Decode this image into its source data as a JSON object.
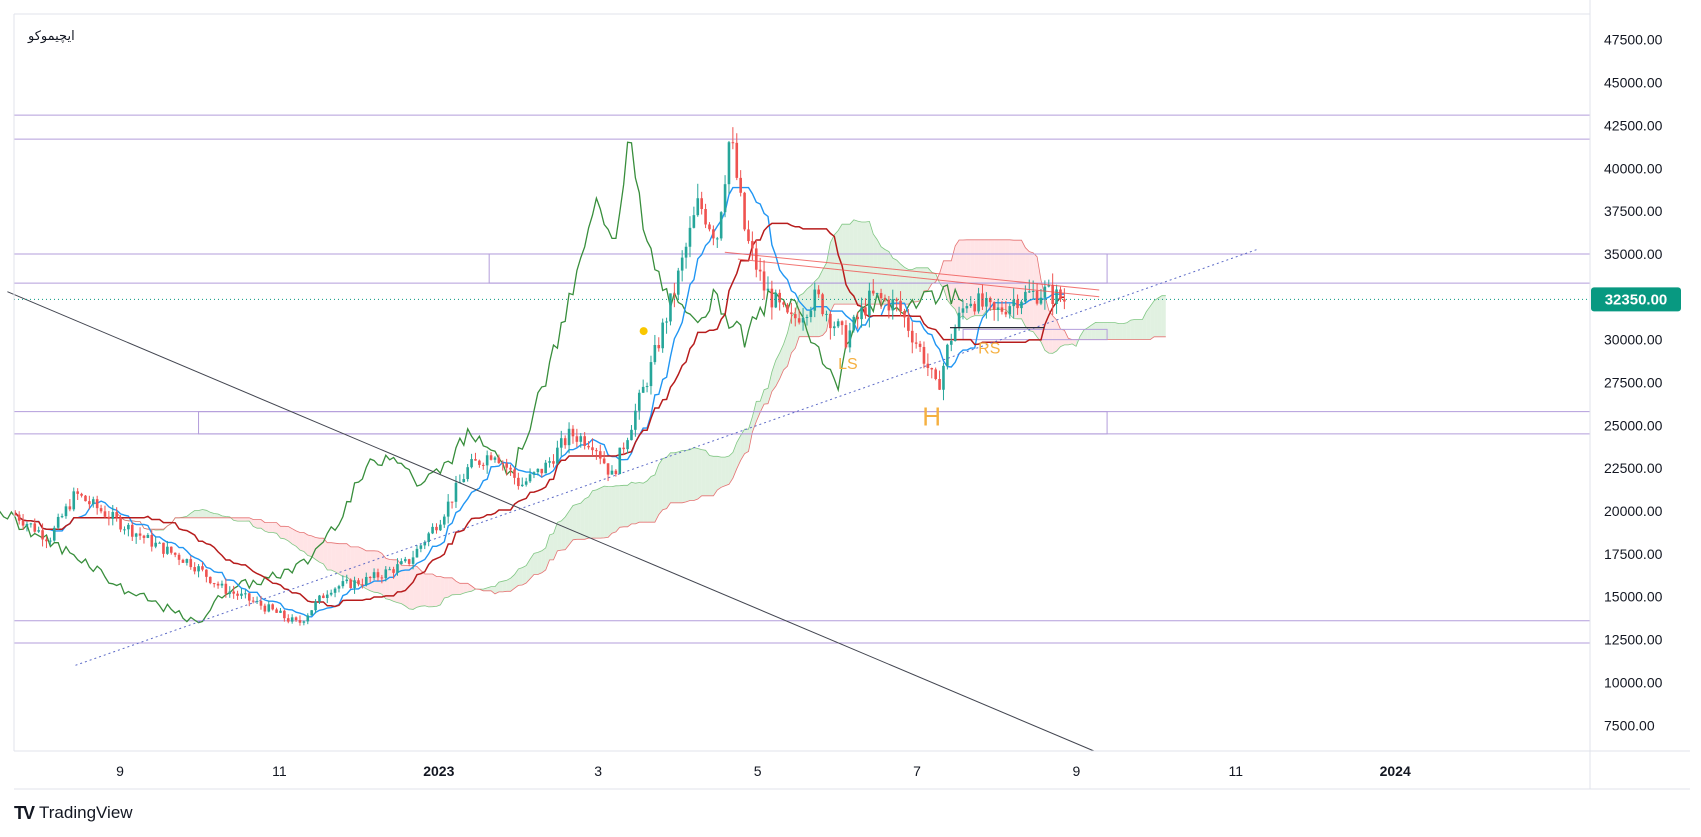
{
  "symbol": "ایچیموکو",
  "brand": {
    "logo": "TV",
    "name": "TradingView"
  },
  "colors": {
    "up": "#26a69a",
    "down": "#ef5350",
    "tenkan": "#2196f3",
    "kijun": "#b71c1c",
    "chikou": "#388e3c",
    "cloud_bull": "#c8e6c9",
    "cloud_bear": "#ffcdd2",
    "zone_border": "#b39ddb",
    "trendline": "#434651",
    "dotted_trend": "#5d6bc7",
    "price_badge": "#089981",
    "pattern_label": "#f5b041",
    "axis_text": "#131722",
    "grid_border": "#e0e3eb"
  },
  "chart_data": {
    "type": "candlestick",
    "indicator": "ichimoku",
    "price_axis": {
      "ticks": [
        47500,
        45000,
        42500,
        40000,
        37500,
        35000,
        32500,
        30000,
        27500,
        25000,
        22500,
        20000,
        17500,
        15000,
        12500,
        10000,
        7500
      ],
      "tick_labels": [
        "47500.00",
        "45000.00",
        "42500.00",
        "40000.00",
        "37500.00",
        "35000.00",
        "32500.00",
        "30000.00",
        "27500.00",
        "25000.00",
        "22500.00",
        "20000.00",
        "17500.00",
        "15000.00",
        "12500.00",
        "10000.00",
        "7500.00"
      ],
      "ylim": [
        6000,
        49000
      ]
    },
    "time_axis": {
      "labels": [
        {
          "text": "9",
          "month": 0,
          "bold": false
        },
        {
          "text": "11",
          "month": 2,
          "bold": false
        },
        {
          "text": "2023",
          "month": 4,
          "bold": true
        },
        {
          "text": "3",
          "month": 6,
          "bold": false
        },
        {
          "text": "5",
          "month": 8,
          "bold": false
        },
        {
          "text": "7",
          "month": 10,
          "bold": false
        },
        {
          "text": "9",
          "month": 12,
          "bold": false
        },
        {
          "text": "11",
          "month": 14,
          "bold": false
        },
        {
          "text": "2024",
          "month": 16,
          "bold": true
        }
      ]
    },
    "last_price": 32350,
    "last_price_label": "32350.00",
    "horizontal_lines": [
      43100,
      41700,
      35000,
      33300,
      25800,
      24500,
      13600,
      12300
    ],
    "zones": [
      {
        "from": "2023-01-20",
        "to": "2023-09-13",
        "low": 33300,
        "high": 35000
      },
      {
        "from": "2022-10-01",
        "to": "2023-09-13",
        "low": 24500,
        "high": 25800
      },
      {
        "from": "2023-07-20",
        "to": "2023-09-13",
        "low": 30000,
        "high": 30600
      }
    ],
    "trendlines": [
      {
        "style": "solid",
        "x1": "2022-07-20",
        "y1": 32800,
        "x2": "2023-09-08",
        "y2": 6000
      },
      {
        "style": "dotted",
        "x1": "2022-08-15",
        "y1": 11000,
        "x2": "2023-11-10",
        "y2": 35300
      },
      {
        "style": "solid-red",
        "x1": "2023-04-20",
        "y1": 35100,
        "x2": "2023-09-10",
        "y2": 32900
      },
      {
        "style": "solid-red",
        "x1": "2023-04-25",
        "y1": 34700,
        "x2": "2023-09-10",
        "y2": 32500
      }
    ],
    "neckline": {
      "x1": "2023-07-15",
      "x2": "2023-08-20",
      "y": 30700
    },
    "pattern_labels": [
      {
        "text": "LS",
        "date": "2023-06-06",
        "price": 28300
      },
      {
        "text": "H",
        "date": "2023-07-08",
        "price": 25000
      },
      {
        "text": "RS",
        "date": "2023-07-30",
        "price": 29200
      }
    ],
    "signal_dot": {
      "date": "2023-03-20",
      "price": 30500
    },
    "price_path": [
      [
        "2022-07-23",
        19800
      ],
      [
        "2022-08-05",
        18400
      ],
      [
        "2022-08-15",
        21000
      ],
      [
        "2022-08-30",
        19500
      ],
      [
        "2022-09-15",
        18000
      ],
      [
        "2022-09-28",
        17000
      ],
      [
        "2022-10-10",
        15500
      ],
      [
        "2022-10-25",
        14500
      ],
      [
        "2022-11-08",
        13400
      ],
      [
        "2022-11-20",
        15500
      ],
      [
        "2022-12-05",
        16000
      ],
      [
        "2022-12-20",
        17000
      ],
      [
        "2023-01-01",
        19500
      ],
      [
        "2023-01-12",
        22500
      ],
      [
        "2023-01-22",
        23500
      ],
      [
        "2023-02-01",
        21500
      ],
      [
        "2023-02-10",
        22500
      ],
      [
        "2023-02-20",
        24500
      ],
      [
        "2023-03-01",
        24000
      ],
      [
        "2023-03-08",
        22000
      ],
      [
        "2023-03-15",
        25000
      ],
      [
        "2023-03-22",
        28000
      ],
      [
        "2023-04-01",
        33000
      ],
      [
        "2023-04-10",
        38000
      ],
      [
        "2023-04-17",
        36000
      ],
      [
        "2023-04-22",
        42000
      ],
      [
        "2023-04-28",
        36000
      ],
      [
        "2023-05-05",
        33000
      ],
      [
        "2023-05-15",
        31000
      ],
      [
        "2023-05-25",
        32500
      ],
      [
        "2023-06-05",
        30000
      ],
      [
        "2023-06-15",
        32500
      ],
      [
        "2023-06-25",
        32000
      ],
      [
        "2023-07-05",
        29000
      ],
      [
        "2023-07-10",
        27000
      ],
      [
        "2023-07-15",
        30000
      ],
      [
        "2023-07-22",
        32500
      ],
      [
        "2023-08-01",
        31500
      ],
      [
        "2023-08-10",
        32500
      ],
      [
        "2023-08-20",
        32800
      ],
      [
        "2023-08-28",
        32300
      ]
    ]
  }
}
